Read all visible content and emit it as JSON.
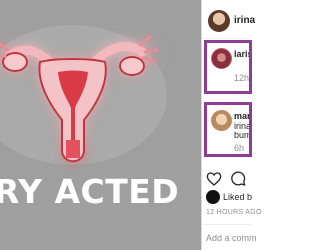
{
  "post": {
    "overlay_text": "RY ACTED"
  },
  "header": {
    "username": "irina"
  },
  "comments": [
    {
      "username": "laris",
      "text": "",
      "time": "12h"
    },
    {
      "username": "mar",
      "text_line1": "irina",
      "text_line2": "bum",
      "time": "6h"
    }
  ],
  "likes": {
    "text": "Liked b"
  },
  "timestamp": "12 HOURS AGO",
  "add_comment": {
    "placeholder": "Add a comm"
  }
}
